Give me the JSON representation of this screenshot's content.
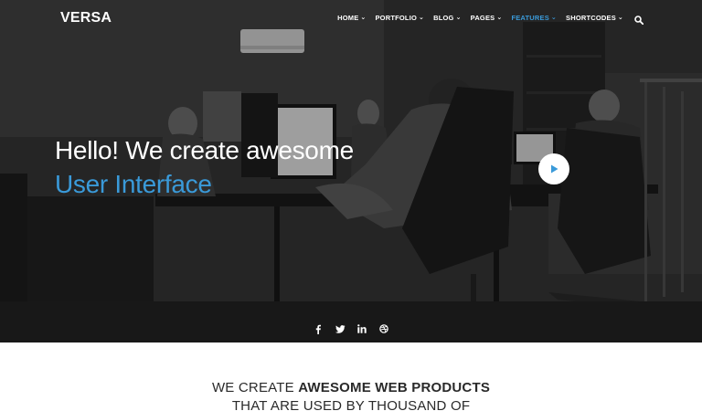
{
  "brand": {
    "logo_text": "VERSA"
  },
  "nav": {
    "items": [
      {
        "label": "HOME",
        "active": false
      },
      {
        "label": "PORTFOLIO",
        "active": false
      },
      {
        "label": "BLOG",
        "active": false
      },
      {
        "label": "PAGES",
        "active": false
      },
      {
        "label": "FEATURES",
        "active": true
      },
      {
        "label": "SHORTCODES",
        "active": false
      }
    ],
    "caret_glyph": "⌄",
    "search_icon": "search-icon"
  },
  "hero": {
    "headline": "Hello! We create awesome",
    "subline": "User Interface",
    "play_icon": "play-icon",
    "socials": [
      "facebook-icon",
      "twitter-icon",
      "linkedin-icon",
      "dribbble-icon"
    ]
  },
  "intro": {
    "line1_prefix": "WE CREATE ",
    "line1_bold": "AWESOME WEB PRODUCTS",
    "line2": "THAT ARE USED BY THOUSAND OF"
  },
  "colors": {
    "accent": "#3a9ad9",
    "hero_text": "#ffffff",
    "body_text": "#2a2a2a"
  }
}
